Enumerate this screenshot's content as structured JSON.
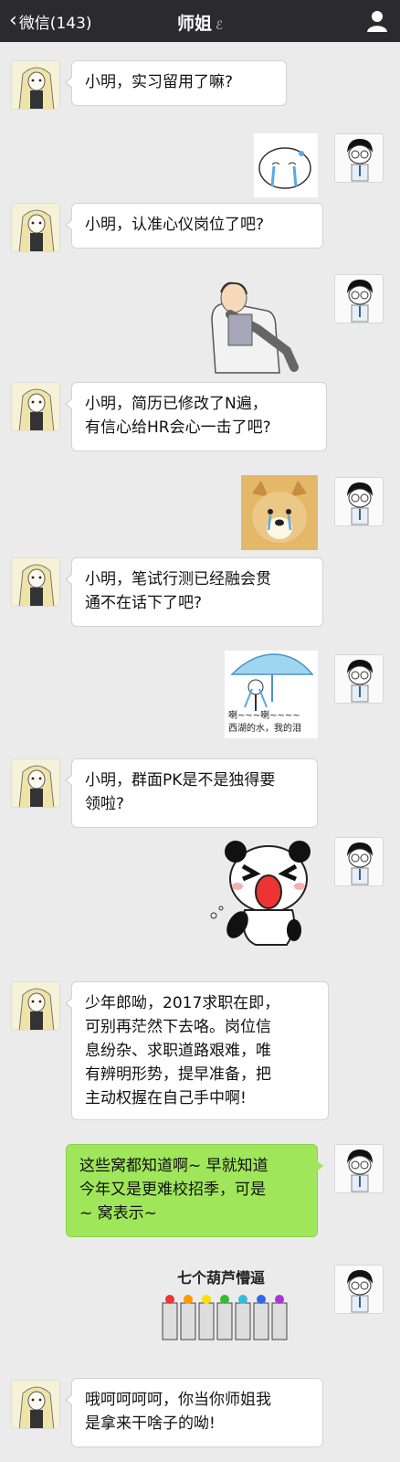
{
  "header": {
    "back_label": "微信(143)",
    "chat_title": "师姐"
  },
  "messages": [
    {
      "sender": "师姐",
      "text": "小明，实习留用了嘛?"
    },
    {
      "sender": "小明",
      "sticker": "crying-blob-sticker"
    },
    {
      "sender": "师姐",
      "text": "小明，认准心仪岗位了吧?"
    },
    {
      "sender": "小明",
      "sticker": "relaxed-man-in-armchair-sticker"
    },
    {
      "sender": "师姐",
      "lines": [
        "小明，简历已修改了N遍，",
        "有信心给HR会心一击了吧?"
      ]
    },
    {
      "sender": "小明",
      "sticker": "crying-doge-sticker"
    },
    {
      "sender": "师姐",
      "lines": [
        "小明，笔试行测已经融会贯",
        "通不在话下了吧?"
      ]
    },
    {
      "sender": "小明",
      "sticker": "umbrella-tears-sticker",
      "caption_1": "喇~~~喇~~~~",
      "caption_2": "西湖的水，我的泪"
    },
    {
      "sender": "师姐",
      "lines": [
        "小明，群面PK是不是独得要",
        "领啦?"
      ]
    },
    {
      "sender": "小明",
      "sticker": "screaming-panda-sticker"
    },
    {
      "sender": "师姐",
      "lines": [
        "少年郎呦，2017求职在即，",
        "可别再茫然下去咯。岗位信",
        "息纷杂、求职道路艰难，唯",
        "有辨明形势，提早准备，把",
        "主动权握在自己手中啊!"
      ]
    },
    {
      "sender": "小明",
      "lines": [
        "这些窝都知道啊~ 早就知道",
        "今年又是更难校招季，可是",
        "~ 窝表示~"
      ]
    },
    {
      "sender": "小明",
      "sticker": "seven-gourd-brothers-sticker",
      "caption": "七个葫芦懵逼"
    },
    {
      "sender": "师姐",
      "lines": [
        "哦呵呵呵呵，你当你师姐我",
        "是拿来干啥子的呦!"
      ]
    }
  ],
  "colors": {
    "header_bg": "#2b2b2e",
    "chat_bg": "#ebebeb",
    "my_bubble": "#9fe65b",
    "their_bubble": "#ffffff"
  }
}
